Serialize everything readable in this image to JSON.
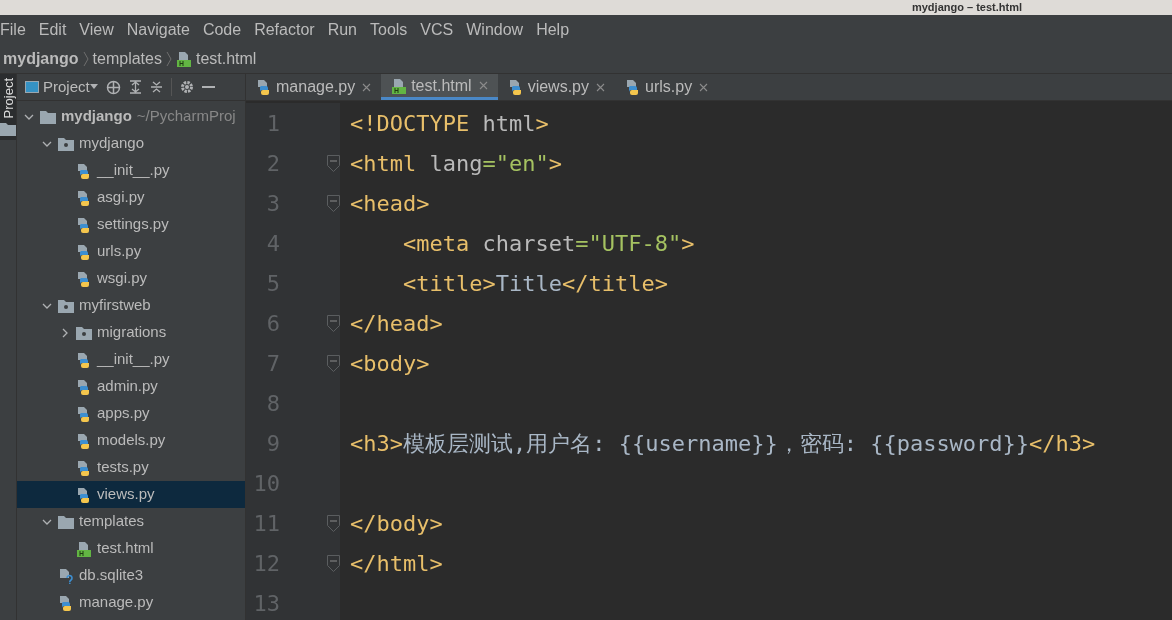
{
  "window": {
    "title": "mydjango – test.html"
  },
  "menu": [
    "File",
    "Edit",
    "View",
    "Navigate",
    "Code",
    "Refactor",
    "Run",
    "Tools",
    "VCS",
    "Window",
    "Help"
  ],
  "breadcrumb": [
    {
      "label": "mydjango",
      "kind": "project"
    },
    {
      "label": "templates",
      "kind": "folder"
    },
    {
      "label": "test.html",
      "kind": "html"
    }
  ],
  "side_stripe": {
    "label": "Project"
  },
  "project_panel": {
    "title": "Project",
    "tree": [
      {
        "label": "mydjango",
        "path": "~/PycharmProj",
        "kind": "root",
        "expanded": true,
        "selected": false,
        "children": [
          {
            "label": "mydjango",
            "kind": "package",
            "expanded": true,
            "selected": false,
            "children": [
              {
                "label": "__init__.py",
                "kind": "python",
                "selected": false
              },
              {
                "label": "asgi.py",
                "kind": "python",
                "selected": false
              },
              {
                "label": "settings.py",
                "kind": "python",
                "selected": false
              },
              {
                "label": "urls.py",
                "kind": "python",
                "selected": false
              },
              {
                "label": "wsgi.py",
                "kind": "python",
                "selected": false
              }
            ]
          },
          {
            "label": "myfirstweb",
            "kind": "package",
            "expanded": true,
            "selected": false,
            "children": [
              {
                "label": "migrations",
                "kind": "package",
                "expanded": false,
                "selected": false
              },
              {
                "label": "__init__.py",
                "kind": "python",
                "selected": false
              },
              {
                "label": "admin.py",
                "kind": "python",
                "selected": false
              },
              {
                "label": "apps.py",
                "kind": "python",
                "selected": false
              },
              {
                "label": "models.py",
                "kind": "python",
                "selected": false
              },
              {
                "label": "tests.py",
                "kind": "python",
                "selected": false
              },
              {
                "label": "views.py",
                "kind": "python",
                "selected": true
              }
            ]
          },
          {
            "label": "templates",
            "kind": "folder",
            "expanded": true,
            "selected": false,
            "children": [
              {
                "label": "test.html",
                "kind": "html",
                "selected": false
              }
            ]
          },
          {
            "label": "db.sqlite3",
            "kind": "unknown",
            "selected": false
          },
          {
            "label": "manage.py",
            "kind": "python",
            "selected": false
          }
        ]
      }
    ]
  },
  "tabs": [
    {
      "label": "manage.py",
      "kind": "python",
      "selected": false
    },
    {
      "label": "test.html",
      "kind": "html",
      "selected": true
    },
    {
      "label": "views.py",
      "kind": "python",
      "selected": false
    },
    {
      "label": "urls.py",
      "kind": "python",
      "selected": false
    }
  ],
  "editor": {
    "lines": [
      {
        "number": "1",
        "fold": false,
        "tokens": [
          {
            "kind": "tag",
            "text": "<!DOCTYPE "
          },
          {
            "kind": "attr",
            "text": "html"
          },
          {
            "kind": "tag",
            "text": ">"
          }
        ]
      },
      {
        "number": "2",
        "fold": true,
        "tokens": [
          {
            "kind": "tag",
            "text": "<html "
          },
          {
            "kind": "attr",
            "text": "lang"
          },
          {
            "kind": "value",
            "text": "=\"en\""
          },
          {
            "kind": "tag",
            "text": ">"
          }
        ]
      },
      {
        "number": "3",
        "fold": true,
        "tokens": [
          {
            "kind": "tag",
            "text": "<head>"
          }
        ]
      },
      {
        "number": "4",
        "fold": false,
        "tokens": [
          {
            "kind": "tag",
            "text": "    <meta "
          },
          {
            "kind": "attr",
            "text": "charset"
          },
          {
            "kind": "value",
            "text": "=\"UTF-8\""
          },
          {
            "kind": "tag",
            "text": ">"
          }
        ]
      },
      {
        "number": "5",
        "fold": false,
        "tokens": [
          {
            "kind": "tag",
            "text": "    <title>"
          },
          {
            "kind": "text",
            "text": "Title"
          },
          {
            "kind": "tag",
            "text": "</title>"
          }
        ]
      },
      {
        "number": "6",
        "fold": true,
        "tokens": [
          {
            "kind": "tag",
            "text": "</head>"
          }
        ]
      },
      {
        "number": "7",
        "fold": true,
        "tokens": [
          {
            "kind": "tag",
            "text": "<body>"
          }
        ]
      },
      {
        "number": "8",
        "fold": false
      },
      {
        "number": "9",
        "fold": false,
        "tokens": [
          {
            "kind": "tag",
            "text": "<h3>"
          },
          {
            "kind": "text",
            "text": "模板层测试,用户名: {{username}}，密码: {{password}}"
          },
          {
            "kind": "tag",
            "text": "</h3>"
          }
        ]
      },
      {
        "number": "10",
        "fold": false
      },
      {
        "number": "11",
        "fold": true,
        "tokens": [
          {
            "kind": "tag",
            "text": "</body>"
          }
        ]
      },
      {
        "number": "12",
        "fold": true,
        "tokens": [
          {
            "kind": "tag",
            "text": "</html>"
          }
        ]
      },
      {
        "number": "13",
        "fold": false
      }
    ]
  }
}
